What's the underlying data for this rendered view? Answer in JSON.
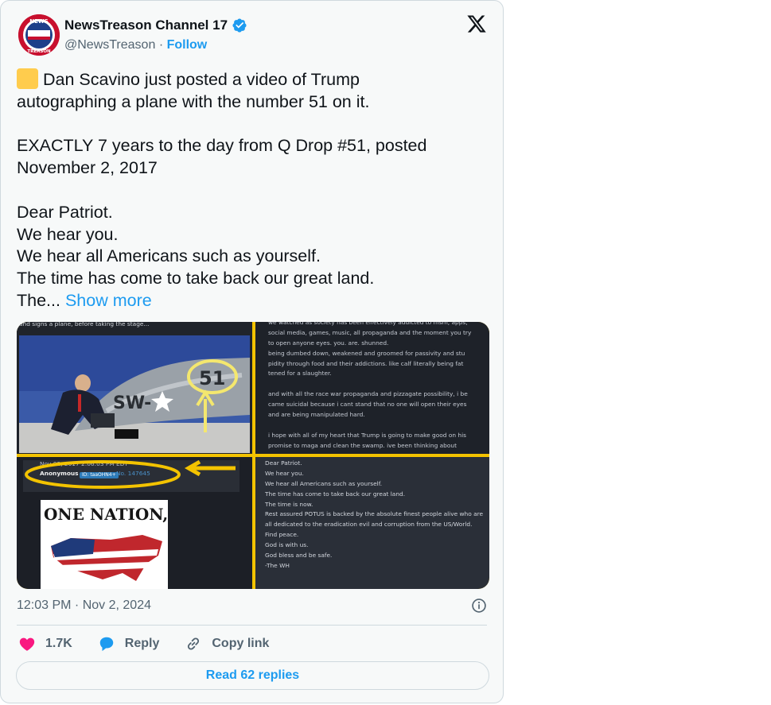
{
  "author": {
    "name": "NewsTreason Channel 17",
    "handle": "@NewsTreason",
    "follow_label": "Follow",
    "avatar_text_top": "NEWS",
    "avatar_text_bottom": "TREASON"
  },
  "tweet": {
    "line1": "Dan Scavino just posted a video of Trump",
    "line2": "autographing a plane with the number 51 on it.",
    "line3": "EXACTLY 7 years to the day from Q Drop #51, posted",
    "line4": "November 2, 2017",
    "line5": "Dear Patriot.",
    "line6": "We hear you.",
    "line7": "We hear all Americans such as yourself.",
    "line8": "The time has come to take back our great land.",
    "line9": "The...",
    "show_more": "Show more"
  },
  "media": {
    "tl_caption": "and signs a plane, before taking the stage...",
    "tr_lines": [
      "we watched as society has been effectively addicted to msm, apps,",
      "social media, games, music, all propaganda and the moment you try",
      "to open anyone eyes. you. are. shunned.",
      "being dumbed down, weakened and groomed for passivity and stu",
      "pidity through food and their addictions. like calf literally being fat",
      "tened for a slaughter.",
      "",
      "and with all the race war propaganda and pizzagate possibility, i be",
      "came suicidal because i cant stand that no one will open their eyes",
      "and are being manipulated hard.",
      "",
      "i hope with all of my heart that Trump is going to make good on his",
      "promise to maga and clean the swamp. ive been thinking about"
    ],
    "bl_date": "Nov 02, 2017 2:06:03 PM EDT",
    "bl_anon": "Anonymous",
    "bl_id": "ID: taaOHN4+",
    "bl_no": "No. 147645",
    "bl_poster": "ONE NATION,",
    "br_lines": [
      "Dear Patriot.",
      "We hear you.",
      "We hear all Americans such as yourself.",
      "The time has come to take back our great land.",
      "The time is now.",
      "Rest assured POTUS is backed by the absolute finest people alive who are",
      "all dedicated to the eradication evil and corruption from the US/World.",
      "Find peace.",
      "God is with us.",
      "God bless and be safe.",
      "-The WH"
    ],
    "plane_text": "SW-",
    "plane_num": "51"
  },
  "meta": {
    "timestamp": "12:03 PM · Nov 2, 2024"
  },
  "actions": {
    "likes": "1.7K",
    "reply": "Reply",
    "copy": "Copy link"
  },
  "read_replies": "Read 62 replies",
  "colors": {
    "accent": "#1d9bf0",
    "like": "#f91880",
    "highlight": "#f3c300"
  }
}
